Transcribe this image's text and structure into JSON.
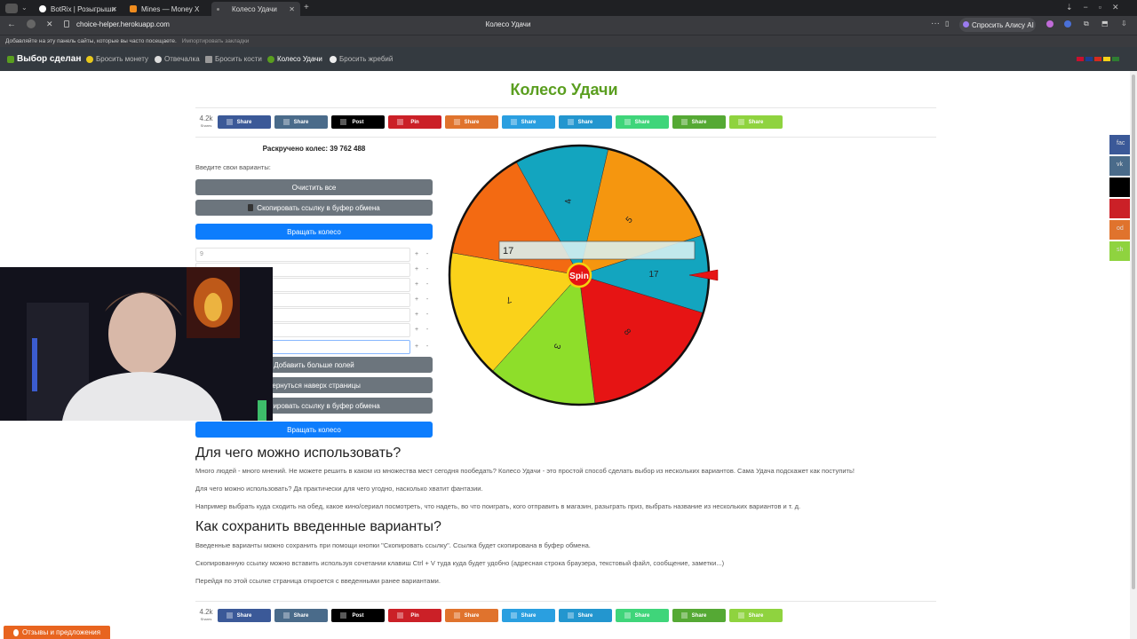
{
  "browser": {
    "tabs": [
      {
        "label": "BotRix | Розыгрыши",
        "color": "#ffffff"
      },
      {
        "label": "Mines — Money X",
        "color": "#f08c1e"
      },
      {
        "label": "Колесо Удачи",
        "color": "#666666"
      }
    ],
    "url": "choice-helper.herokuapp.com",
    "page_title": "Колесо Удачи",
    "assistant_button": "Спросить Алису AI",
    "bookmarks_hint": "Добавляйте на эту панель сайты, которые вы часто посещаете.",
    "bookmarks_import": "Импортировать закладки"
  },
  "sitenav": {
    "brand": "Выбор сделан",
    "items": [
      "Бросить монету",
      "Отвечалка",
      "Бросить кости",
      "Колесо Удачи",
      "Бросить жребий"
    ]
  },
  "page": {
    "title": "Колесо Удачи",
    "share_count": "4.2k",
    "share_count_label": "Shares",
    "share_buttons": [
      {
        "label": "Share",
        "color": "#3b5998"
      },
      {
        "label": "Share",
        "color": "#4a6b8a"
      },
      {
        "label": "Post",
        "color": "#000000"
      },
      {
        "label": "Pin",
        "color": "#cb2027"
      },
      {
        "label": "Share",
        "color": "#e0732d"
      },
      {
        "label": "Share",
        "color": "#2a9fe0"
      },
      {
        "label": "Share",
        "color": "#2396cf"
      },
      {
        "label": "Share",
        "color": "#3fd57a"
      },
      {
        "label": "Share",
        "color": "#55a934"
      },
      {
        "label": "Share",
        "color": "#8fd33f"
      }
    ],
    "spun_counter": "Раскручено колес: 39 762 488",
    "prompt": "Введите свои варианты:",
    "clear_all": "Очистить все",
    "copy_link_icon": "clipboard-icon",
    "copy_link": "Скопировать ссылку в буфер обмена",
    "spin_wheel": "Вращать колесо",
    "first_option_value": "9",
    "add_more": "Добавить больше полей",
    "back_to_top": "Вернуться наверх страницы",
    "plus": "+",
    "minus": "-"
  },
  "wheel": {
    "spin_label": "Spin",
    "result": "17",
    "segments": [
      {
        "label": "17",
        "color": "#13a5bf"
      },
      {
        "label": "8",
        "color": "#e61414"
      },
      {
        "label": "3",
        "color": "#8ede2a"
      },
      {
        "label": "7",
        "color": "#fad21a"
      },
      {
        "label": "",
        "color": "#f36a12"
      },
      {
        "label": "4",
        "color": "#13a5bf"
      },
      {
        "label": "5",
        "color": "#f5960f"
      }
    ]
  },
  "content": {
    "h_use": "Для чего можно использовать?",
    "p1": "Много людей - много мнений. Не можете решить в каком из множества мест сегодня пообедать? Колесо Удачи - это простой способ сделать выбор из нескольких вариантов. Сама Удача подскажет как поступить!",
    "p2": "Для чего можно использовать? Да практически для чего угодно, насколько хватит фантазии.",
    "p3": "Например выбрать куда сходить на обед, какое кино/сериал посмотреть, что надеть, во что поиграть, кого отправить в магазин, разыграть приз, выбрать название из нескольких вариантов и т. д.",
    "h_save": "Как сохранить введенные варианты?",
    "p4": "Введенные варианты можно сохранить при помощи кнопки \"Скопировать ссылку\". Ссылка будет скопирована в буфер обмена.",
    "p5": "Скопированную ссылку можно вставить используя сочетании клавиш Ctrl + V туда куда будет удобно (адресная строка браузера, текстовый файл, сообщение, заметки...)",
    "p6": "Перейдя по этой ссылке страница откроется с введенными ранее вариантами."
  },
  "sidebar_share": [
    {
      "label": "fac",
      "color": "#3b5998"
    },
    {
      "label": "vk",
      "color": "#4a6b8a"
    },
    {
      "label": "",
      "color": "#000000"
    },
    {
      "label": "",
      "color": "#cb2027"
    },
    {
      "label": "od",
      "color": "#e0732d"
    },
    {
      "label": "sh",
      "color": "#8fd33f"
    }
  ],
  "feedback": "Отзывы и предложения"
}
